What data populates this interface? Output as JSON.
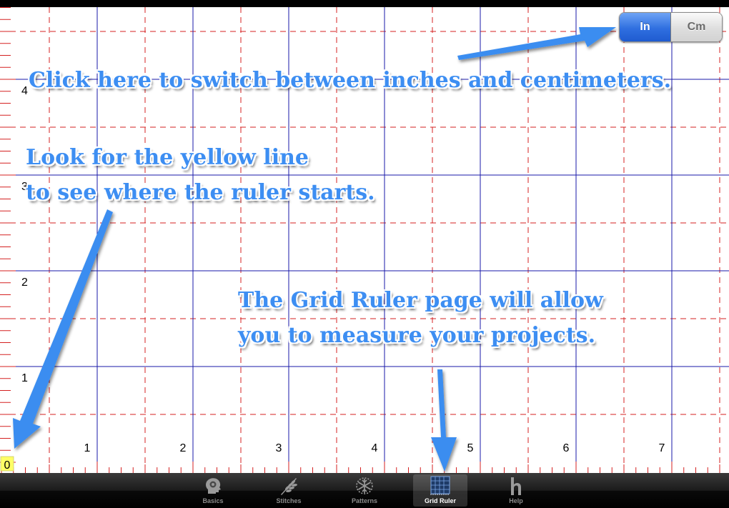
{
  "unit_toggle": {
    "options": [
      "In",
      "Cm"
    ],
    "selected": "In",
    "selected_color": "#2f6fe0"
  },
  "ruler": {
    "x_labels": [
      "1",
      "2",
      "3",
      "4",
      "5",
      "6",
      "7"
    ],
    "y_labels": [
      "1",
      "2",
      "3",
      "4"
    ],
    "origin_label": "0",
    "origin_color": "#ffff66",
    "major_line_color": "#1a1aa8",
    "minor_line_color": "#d42020"
  },
  "callouts": {
    "units": [
      "Click here to switch between inches and centimeters."
    ],
    "yellow": [
      "Look for the yellow line",
      "to see where the ruler starts."
    ],
    "ruler": [
      "The Grid Ruler page will allow",
      "you to measure your projects."
    ],
    "color": "#3d8ef2"
  },
  "tabbar": {
    "active": "Grid Ruler",
    "tabs": [
      {
        "label": "Basics",
        "icon": "head-icon"
      },
      {
        "label": "Stitches",
        "icon": "wheat-icon"
      },
      {
        "label": "Patterns",
        "icon": "snowflake-icon"
      },
      {
        "label": "Grid Ruler",
        "icon": "grid-ruler-icon"
      },
      {
        "label": "Help",
        "icon": "help-h-icon"
      }
    ]
  }
}
